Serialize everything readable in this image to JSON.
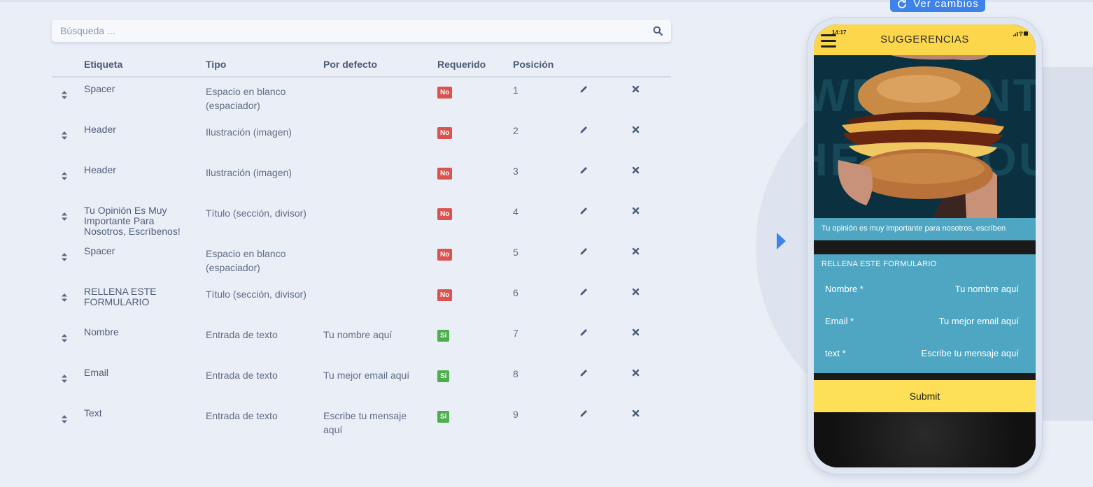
{
  "search": {
    "placeholder": "Búsqueda ..."
  },
  "table": {
    "headers": {
      "label": "Etiqueta",
      "type": "Tipo",
      "default": "Por defecto",
      "required": "Requerido",
      "position": "Posición"
    },
    "rows": [
      {
        "label": "Spacer",
        "type": "Espacio en blanco (espaciador)",
        "default": "",
        "required": "No",
        "position": "1"
      },
      {
        "label": "Header",
        "type": "Ilustración (imagen)",
        "default": "",
        "required": "No",
        "position": "2"
      },
      {
        "label": "Header",
        "type": "Ilustración (imagen)",
        "default": "",
        "required": "No",
        "position": "3"
      },
      {
        "label": "Tu Opinión Es Muy Importante Para Nosotros, Escríbenos!",
        "type": "Título (sección, divisor)",
        "default": "",
        "required": "No",
        "position": "4"
      },
      {
        "label": "Spacer",
        "type": "Espacio en blanco (espaciador)",
        "default": "",
        "required": "No",
        "position": "5"
      },
      {
        "label": "RELLENA ESTE FORMULARIO",
        "type": "Título (sección, divisor)",
        "default": "",
        "required": "No",
        "position": "6"
      },
      {
        "label": "Nombre",
        "type": "Entrada de texto",
        "default": "Tu nombre aquí",
        "required": "Sí",
        "position": "7"
      },
      {
        "label": "Email",
        "type": "Entrada de texto",
        "default": "Tu mejor email aquí",
        "required": "Sí",
        "position": "8"
      },
      {
        "label": "Text",
        "type": "Entrada de texto",
        "default": "Escribe tu mensaje aquí",
        "required": "Sí",
        "position": "9"
      }
    ]
  },
  "preview": {
    "button_label": "Ver cambios",
    "phone": {
      "time": "14:17",
      "title": "SUGGERENCIAS",
      "image_text": "WE WANT HEAR YOU",
      "opinion": "Tu opinión es muy importante para nosotros, escríben",
      "form_title": "RELLENA ESTE FORMULARIO",
      "fields": [
        {
          "label": "Nombre *",
          "placeholder": "Tu nombre aquí"
        },
        {
          "label": "Email *",
          "placeholder": "Tu mejor email aquí"
        },
        {
          "label": "text *",
          "placeholder": "Escribe tu mensaje aquí"
        }
      ],
      "submit": "Submit"
    }
  },
  "colors": {
    "accent": "#3e83e9",
    "badge_no": "#d9534f",
    "badge_si": "#4cae4c",
    "phone_header": "#fcd74c",
    "form_bg": "#4fa6c2"
  },
  "icons": [
    "search-icon",
    "sort-handle-icon",
    "pencil-icon",
    "close-icon",
    "refresh-icon",
    "hamburger-menu-icon"
  ]
}
